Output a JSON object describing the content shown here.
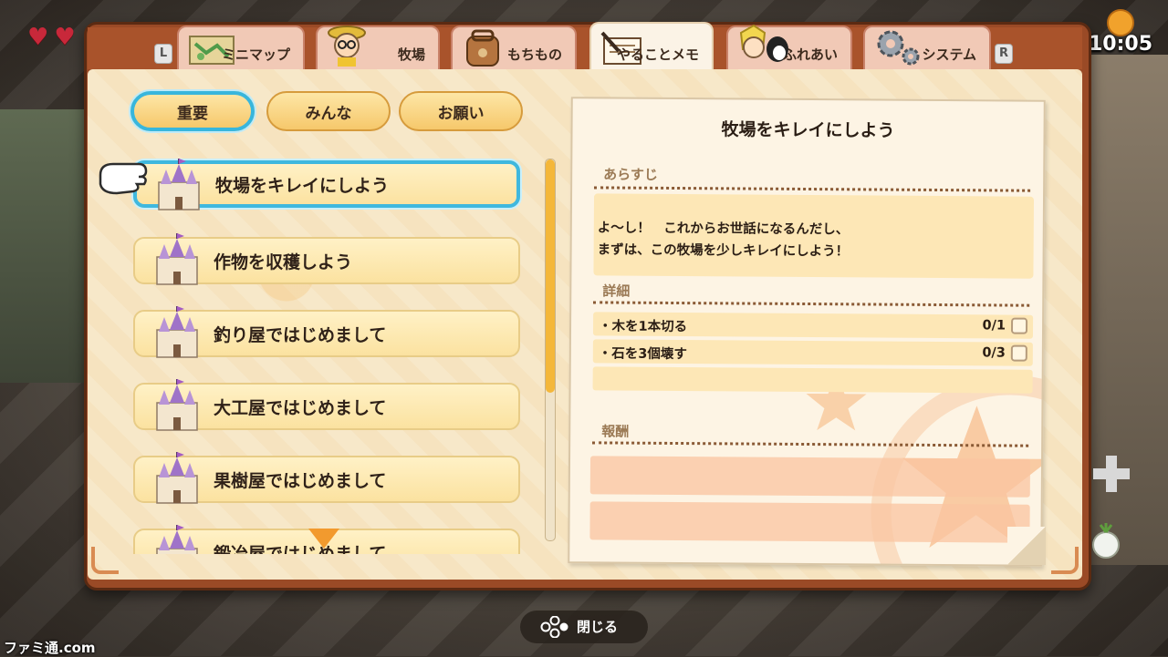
{
  "hud": {
    "hearts": [
      "heart",
      "heart"
    ],
    "time": "10:05",
    "weather_icon": "sun-icon",
    "watermark": "ファミ通.com"
  },
  "tabs": [
    {
      "label": "ミニマップ",
      "icon": "map-icon",
      "active": false
    },
    {
      "label": "牧場",
      "icon": "nobita-portrait-icon",
      "active": false
    },
    {
      "label": "もちもの",
      "icon": "backpack-icon",
      "active": false
    },
    {
      "label": "やることメモ",
      "icon": "notebook-icon",
      "active": true
    },
    {
      "label": "ふれあい",
      "icon": "friends-portrait-icon",
      "active": false
    },
    {
      "label": "システム",
      "icon": "gear-icon",
      "active": false
    }
  ],
  "shoulder_buttons": {
    "left": "L",
    "right": "R"
  },
  "filters": [
    {
      "label": "重要",
      "selected": true
    },
    {
      "label": "みんな",
      "selected": false
    },
    {
      "label": "お願い",
      "selected": false
    }
  ],
  "quests": [
    {
      "label": "牧場をキレイにしよう",
      "selected": true
    },
    {
      "label": "作物を収穫しよう",
      "selected": false
    },
    {
      "label": "釣り屋ではじめまして",
      "selected": false
    },
    {
      "label": "大工屋ではじめまして",
      "selected": false
    },
    {
      "label": "果樹屋ではじめまして",
      "selected": false
    },
    {
      "label": "鍛冶屋ではじめまして",
      "selected": false
    }
  ],
  "detail": {
    "title": "牧場をキレイにしよう",
    "summary_heading": "あらすじ",
    "summary_lines": [
      "よ～し！　これからお世話になるんだし、",
      "まずは、この牧場を少しキレイにしよう！"
    ],
    "details_heading": "詳細",
    "tasks": [
      {
        "label": "・木を1本切る",
        "count": "0/1",
        "done": false
      },
      {
        "label": "・石を3個壊す",
        "count": "0/3",
        "done": false
      }
    ],
    "reward_heading": "報酬"
  },
  "footer": {
    "close_label": "閉じる",
    "button_icon": "face-buttons-icon"
  },
  "colors": {
    "frame": "#9a4a26",
    "paper": "#f7e8c9",
    "selection": "#3fb8de",
    "quest_fill": "#fbe2a0",
    "scroll_thumb": "#f4b73a"
  }
}
